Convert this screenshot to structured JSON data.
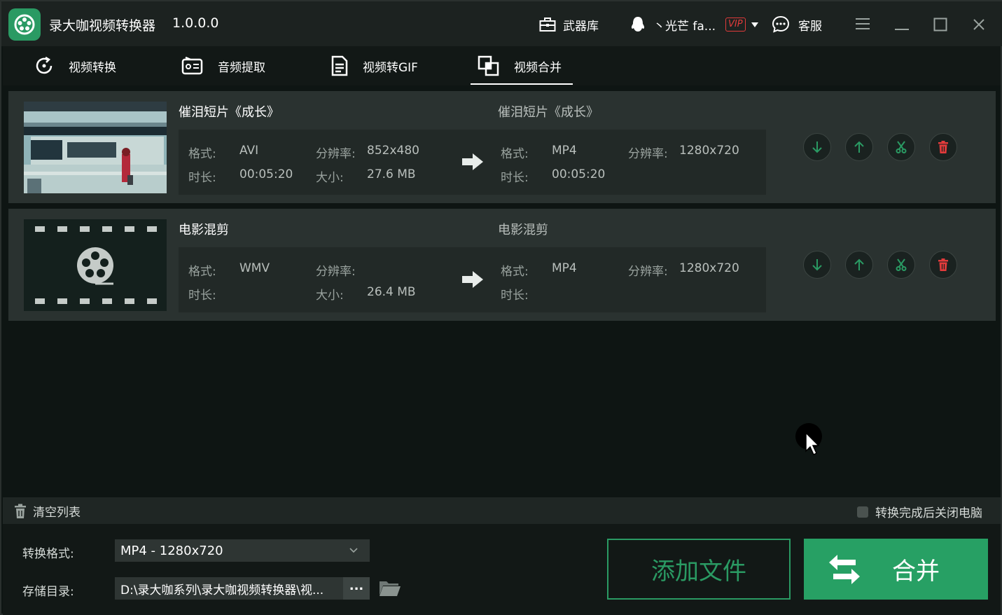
{
  "app": {
    "title": "录大咖视频转换器",
    "version": "1.0.0.0"
  },
  "titlebar": {
    "arsenal_label": "武器库",
    "user_name": "丶光芒 fa...",
    "vip_badge": "VIP",
    "support_label": "客服"
  },
  "tabs": [
    {
      "label": "视频转换",
      "icon": "convert-icon",
      "active": false
    },
    {
      "label": "音频提取",
      "icon": "audio-extract-icon",
      "active": false
    },
    {
      "label": "视频转GIF",
      "icon": "gif-icon",
      "active": false
    },
    {
      "label": "视频合并",
      "icon": "merge-icon",
      "active": true
    }
  ],
  "labels": {
    "format": "格式:",
    "duration": "时长:",
    "resolution": "分辨率:",
    "size": "大小:"
  },
  "files": [
    {
      "name": "催泪短片《成长》",
      "src": {
        "format": "AVI",
        "duration": "00:05:20",
        "resolution": "852x480",
        "size": "27.6 MB"
      },
      "dst_name": "催泪短片《成长》",
      "dst": {
        "format": "MP4",
        "duration": "00:05:20",
        "resolution": "1280x720"
      }
    },
    {
      "name": "电影混剪",
      "src": {
        "format": "WMV",
        "duration": "",
        "resolution": "",
        "size": "26.4 MB"
      },
      "dst_name": "电影混剪",
      "dst": {
        "format": "MP4",
        "duration": "",
        "resolution": "1280x720"
      }
    }
  ],
  "toolbar": {
    "clear_label": "清空列表",
    "shutdown_label": "转换完成后关闭电脑",
    "shutdown_checked": false
  },
  "output": {
    "format_label": "转换格式:",
    "format_value": "MP4 - 1280x720",
    "dir_label": "存储目录:",
    "dir_value": "D:\\录大咖系列\\录大咖视频转换器\\视...",
    "browse_label": "..."
  },
  "buttons": {
    "add_files": "添加文件",
    "merge": "合并"
  },
  "colors": {
    "accent": "#27a064",
    "danger": "#e23b3b",
    "background": "#0e1513"
  }
}
